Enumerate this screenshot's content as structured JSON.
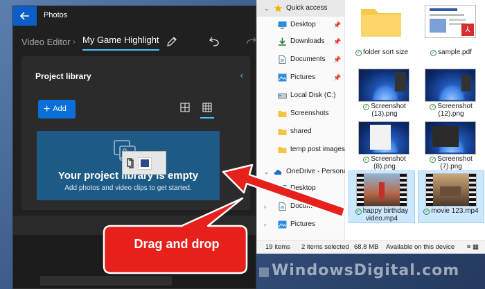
{
  "photos": {
    "app_name": "Photos",
    "breadcrumb_root": "Video Editor",
    "project_title": "My Game Highlight",
    "panel_title": "Project library",
    "add_label": "Add",
    "empty_title": "Your project library is empty",
    "empty_subtitle": "Add photos and video clips to get started.",
    "drag_count": "2",
    "accent": "#0a6fd8"
  },
  "explorer": {
    "nav": [
      {
        "label": "Quick access",
        "icon": "star-icon"
      },
      {
        "label": "Desktop",
        "icon": "desktop-icon",
        "pinned": true
      },
      {
        "label": "Downloads",
        "icon": "download-icon",
        "pinned": true
      },
      {
        "label": "Documents",
        "icon": "document-icon",
        "pinned": true
      },
      {
        "label": "Pictures",
        "icon": "pictures-icon",
        "pinned": true
      },
      {
        "label": "Local Disk (C:)",
        "icon": "drive-icon"
      },
      {
        "label": "Screenshots",
        "icon": "folder-icon"
      },
      {
        "label": "shared",
        "icon": "folder-icon"
      },
      {
        "label": "temp post images",
        "icon": "folder-icon"
      },
      {
        "label": "OneDrive - Personal",
        "icon": "cloud-icon"
      },
      {
        "label": "Desktop",
        "icon": "desktop-icon"
      },
      {
        "label": "Documents",
        "icon": "document-icon"
      },
      {
        "label": "Pictures",
        "icon": "pictures-icon"
      }
    ],
    "files": [
      {
        "name": "folder sort size",
        "kind": "folder"
      },
      {
        "name": "sample.pdf",
        "kind": "pdf"
      },
      {
        "name": "Screenshot (13).png",
        "kind": "image"
      },
      {
        "name": "Screenshot (12).png",
        "kind": "image"
      },
      {
        "name": "Screenshot (8).png",
        "kind": "image"
      },
      {
        "name": "Screenshot (7).png",
        "kind": "image"
      },
      {
        "name": "happy birthday video.mp4",
        "kind": "video",
        "selected": true
      },
      {
        "name": "movie 123.mp4",
        "kind": "video",
        "selected": true
      }
    ],
    "status": {
      "items": "19 items",
      "selected": "2 items selected",
      "size": "68.8 MB",
      "availability": "Available on this device"
    }
  },
  "annotation": {
    "callout": "Drag and drop",
    "arrow_color": "#e8201b"
  },
  "watermark": "WindowsDigital.com"
}
